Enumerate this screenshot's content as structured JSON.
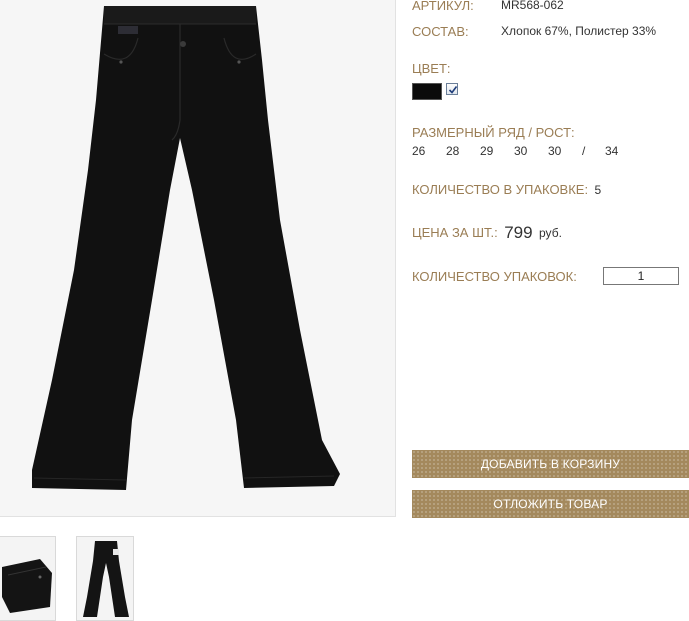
{
  "product": {
    "article_label": "АРТИКУЛ:",
    "article_value": "MR568-062",
    "composition_label": "СОСТАВ:",
    "composition_value": "Хлопок 67%, Полистер 33%",
    "color_label": "ЦВЕТ:",
    "colors": [
      "#0b0b0b"
    ],
    "sizes_label": "РАЗМЕРНЫЙ РЯД / РОСТ:",
    "sizes": [
      "26",
      "28",
      "29",
      "30",
      "30",
      "/",
      "34"
    ],
    "pack_qty_label": "КОЛИЧЕСТВО В УПАКОВКЕ:",
    "pack_qty_value": "5",
    "price_label": "ЦЕНА ЗА ШТ.:",
    "price_value": "799",
    "price_currency": "руб.",
    "packs_label": "КОЛИЧЕСТВО УПАКОВОК:",
    "packs_value": "1"
  },
  "actions": {
    "add_to_cart": "ДОБАВИТЬ В КОРЗИНУ",
    "defer": "ОТЛОЖИТЬ ТОВАР"
  },
  "theme": {
    "label_color": "#9a7d54",
    "button_color": "#a4895d"
  }
}
